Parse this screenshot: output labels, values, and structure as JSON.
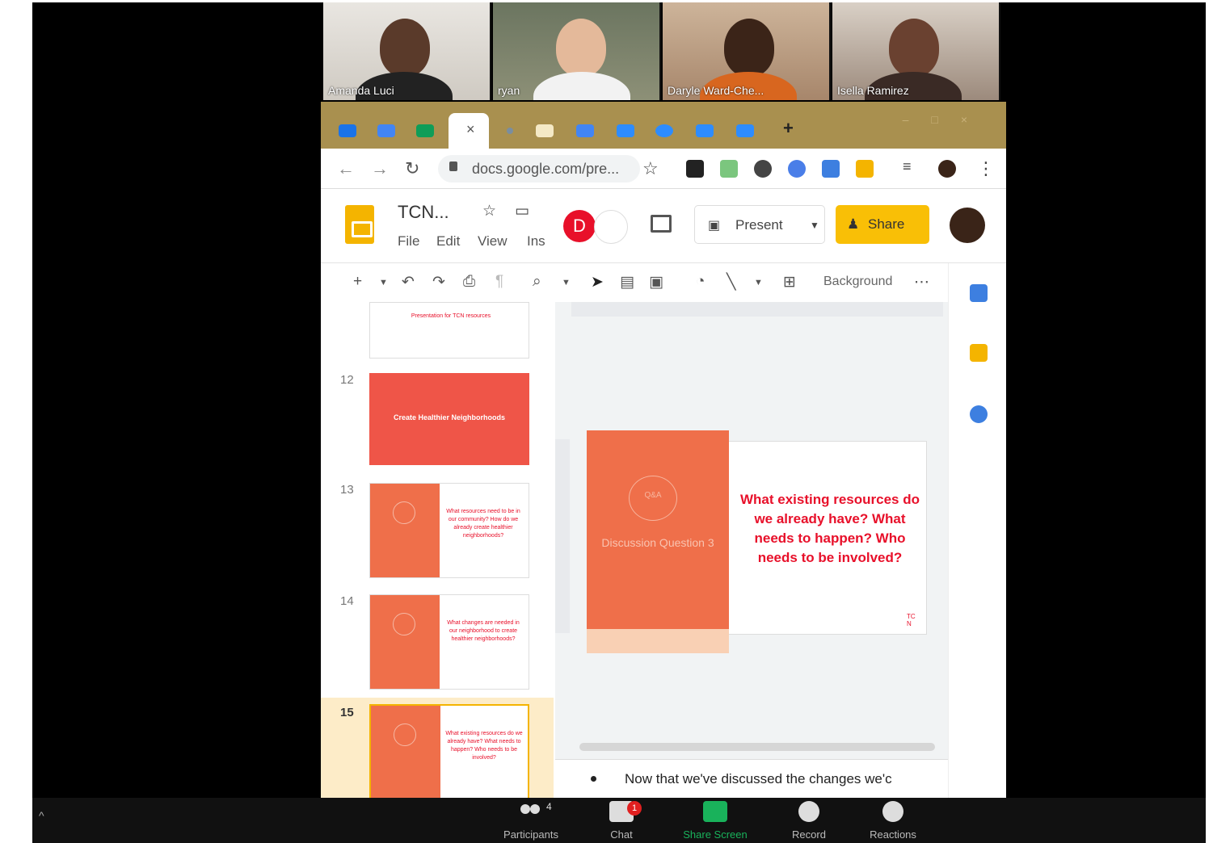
{
  "participants": [
    {
      "name": "Amanda Luci"
    },
    {
      "name": "ryan"
    },
    {
      "name": "Daryle Ward-Che..."
    },
    {
      "name": "Isella Ramirez"
    }
  ],
  "browser": {
    "url": "docs.google.com/pre..."
  },
  "docs": {
    "title": "TCN...",
    "menu": [
      "File",
      "Edit",
      "View",
      "Ins"
    ],
    "collaborator_initial": "D",
    "present_label": "Present",
    "share_label": "Share",
    "toolbar_background": "Background"
  },
  "filmstrip": {
    "slides": [
      {
        "num": "12",
        "text": "Create Healthier Neighborhoods"
      },
      {
        "num": "13",
        "text": "What resources need to be in our community? How do we already create healthier neighborhoods?"
      },
      {
        "num": "14",
        "text": "What changes are needed in our neighborhood to create healthier neighborhoods?"
      },
      {
        "num": "15",
        "text": "What existing resources do we already have? What needs to happen? Who needs to be involved?"
      }
    ],
    "top_partial_text": "Presentation for TCN resources"
  },
  "slide": {
    "bubble_text": "Q&A",
    "label": "Discussion Question 3",
    "question": "What existing resources do we already have? What needs to happen? Who needs to be involved?",
    "logo": "TC N"
  },
  "notes": {
    "text": "Now that we've discussed the changes we'c"
  },
  "zoom": {
    "participants_label": "Participants",
    "participants_count": "4",
    "chat_label": "Chat",
    "chat_badge": "1",
    "share_label": "Share Screen",
    "record_label": "Record",
    "reactions_label": "Reactions"
  },
  "colors": {
    "accent_orange": "#ef6f4a",
    "accent_red": "#e8102a",
    "share_green": "#19b25b",
    "share_yellow": "#f9bf06"
  }
}
